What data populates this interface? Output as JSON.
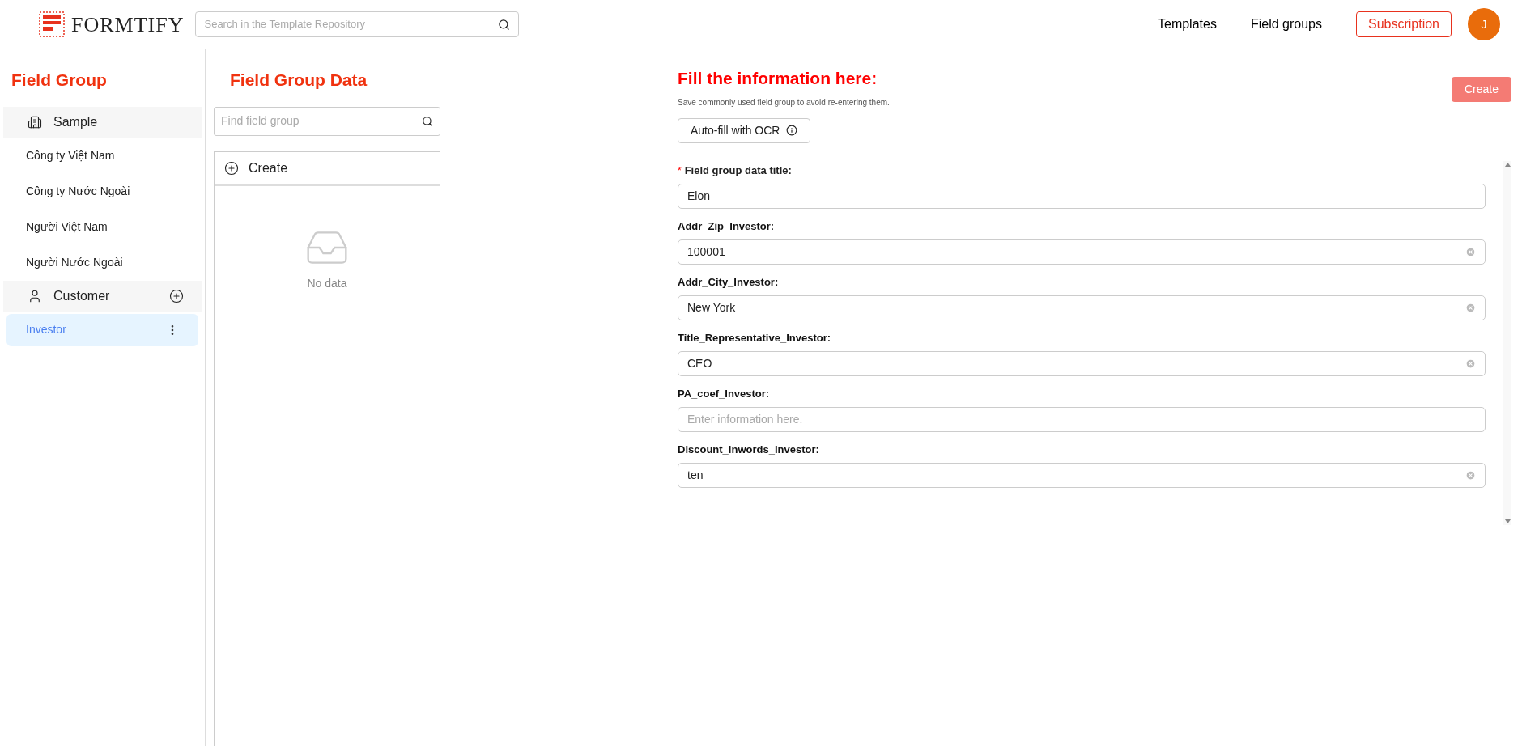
{
  "header": {
    "brand": "FORMTIFY",
    "search": {
      "placeholder": "Search in the Template Repository"
    },
    "nav": [
      {
        "label": "Templates",
        "kind": "link"
      },
      {
        "label": "Field groups",
        "kind": "link"
      },
      {
        "label": "Subscription",
        "kind": "outlined"
      }
    ],
    "avatar": "J"
  },
  "sidebar": {
    "title": "Field Group",
    "groups": [
      {
        "label": "Sample",
        "kind": "organization",
        "can_add": false,
        "children": [
          {
            "label": "Công ty Việt Nam",
            "selected": false
          },
          {
            "label": "Công ty Nước Ngoài",
            "selected": false
          },
          {
            "label": "Người Việt Nam",
            "selected": false
          },
          {
            "label": "Người Nước Ngoài",
            "selected": false
          }
        ]
      },
      {
        "label": "Customer",
        "kind": "person",
        "can_add": true,
        "children": [
          {
            "label": "Investor",
            "selected": true
          }
        ]
      }
    ]
  },
  "data_panel": {
    "title": "Field Group Data",
    "search": {
      "placeholder": "Find field group"
    },
    "create": "Create",
    "empty": "No data"
  },
  "form": {
    "title": "Fill the information here:",
    "subtitle": "Save commonly used field group to avoid re-entering them.",
    "create": "Create",
    "ocr": "Auto-fill with OCR",
    "fields": [
      {
        "marker": "*",
        "label": "Field group data title:",
        "required": true,
        "clear_button": false,
        "value": "Elon"
      },
      {
        "label": "Addr_Zip_Investor:",
        "required": false,
        "clear_button": true,
        "value": "100001"
      },
      {
        "label": "Addr_City_Investor:",
        "required": false,
        "clear_button": true,
        "value": "New York"
      },
      {
        "label": "Title_Representative_Investor:",
        "required": false,
        "clear_button": true,
        "value": "CEO"
      },
      {
        "label": "PA_coef_Investor:",
        "required": false,
        "clear_button": false,
        "placeholder": "Enter information here."
      },
      {
        "label": "Discount_Inwords_Investor:",
        "required": false,
        "clear_button": true,
        "value": "ten"
      }
    ]
  }
}
